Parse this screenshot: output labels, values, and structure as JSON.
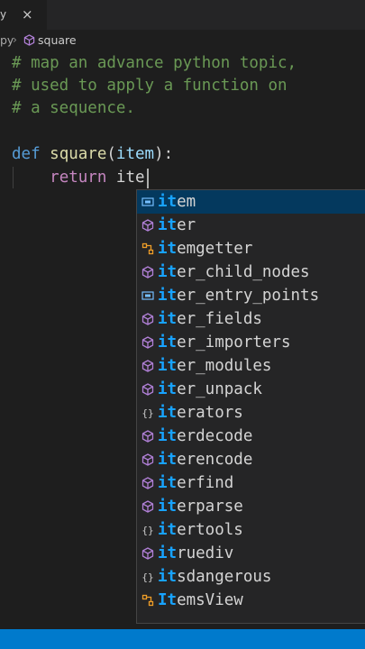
{
  "tab": {
    "label": "y",
    "close": "×"
  },
  "breadcrumb": {
    "file": "py",
    "separator": "›",
    "symbol": "square",
    "symbol_icon": "cube-icon"
  },
  "code": {
    "comment1": "# map an advance python topic,",
    "comment2": "# used to apply a function on",
    "comment3": "# a sequence.",
    "def_kw": "def",
    "fn_name": "square",
    "open": "(",
    "param": "item",
    "close": "):",
    "return_kw": "return",
    "typed": "ite"
  },
  "suggestions": [
    {
      "prefix": "it",
      "rest": "em",
      "icon": "variable-icon",
      "selected": true
    },
    {
      "prefix": "it",
      "rest": "er",
      "icon": "cube-icon"
    },
    {
      "prefix": "it",
      "rest": "emgetter",
      "icon": "class-icon"
    },
    {
      "prefix": "it",
      "rest": "er_child_nodes",
      "icon": "cube-icon"
    },
    {
      "prefix": "it",
      "rest": "er_entry_points",
      "icon": "variable-icon"
    },
    {
      "prefix": "it",
      "rest": "er_fields",
      "icon": "cube-icon"
    },
    {
      "prefix": "it",
      "rest": "er_importers",
      "icon": "cube-icon"
    },
    {
      "prefix": "it",
      "rest": "er_modules",
      "icon": "cube-icon"
    },
    {
      "prefix": "it",
      "rest": "er_unpack",
      "icon": "cube-icon"
    },
    {
      "prefix": "it",
      "rest": "erators",
      "icon": "module-icon"
    },
    {
      "prefix": "it",
      "rest": "erdecode",
      "icon": "cube-icon"
    },
    {
      "prefix": "it",
      "rest": "erencode",
      "icon": "cube-icon"
    },
    {
      "prefix": "it",
      "rest": "erfind",
      "icon": "cube-icon"
    },
    {
      "prefix": "it",
      "rest": "erparse",
      "icon": "cube-icon"
    },
    {
      "prefix": "it",
      "rest": "ertools",
      "icon": "module-icon"
    },
    {
      "prefix": "it",
      "rest": "ruediv",
      "icon": "cube-icon"
    },
    {
      "prefix": "it",
      "rest": "sdangerous",
      "icon": "module-icon"
    },
    {
      "prefix": "It",
      "rest": "emsView",
      "icon": "class-icon"
    }
  ],
  "colors": {
    "accent": "#007acc",
    "selection": "#04395e",
    "match": "#18a3ff",
    "cube": "#b180d7",
    "class": "#ee9d28",
    "variable": "#75beff"
  }
}
